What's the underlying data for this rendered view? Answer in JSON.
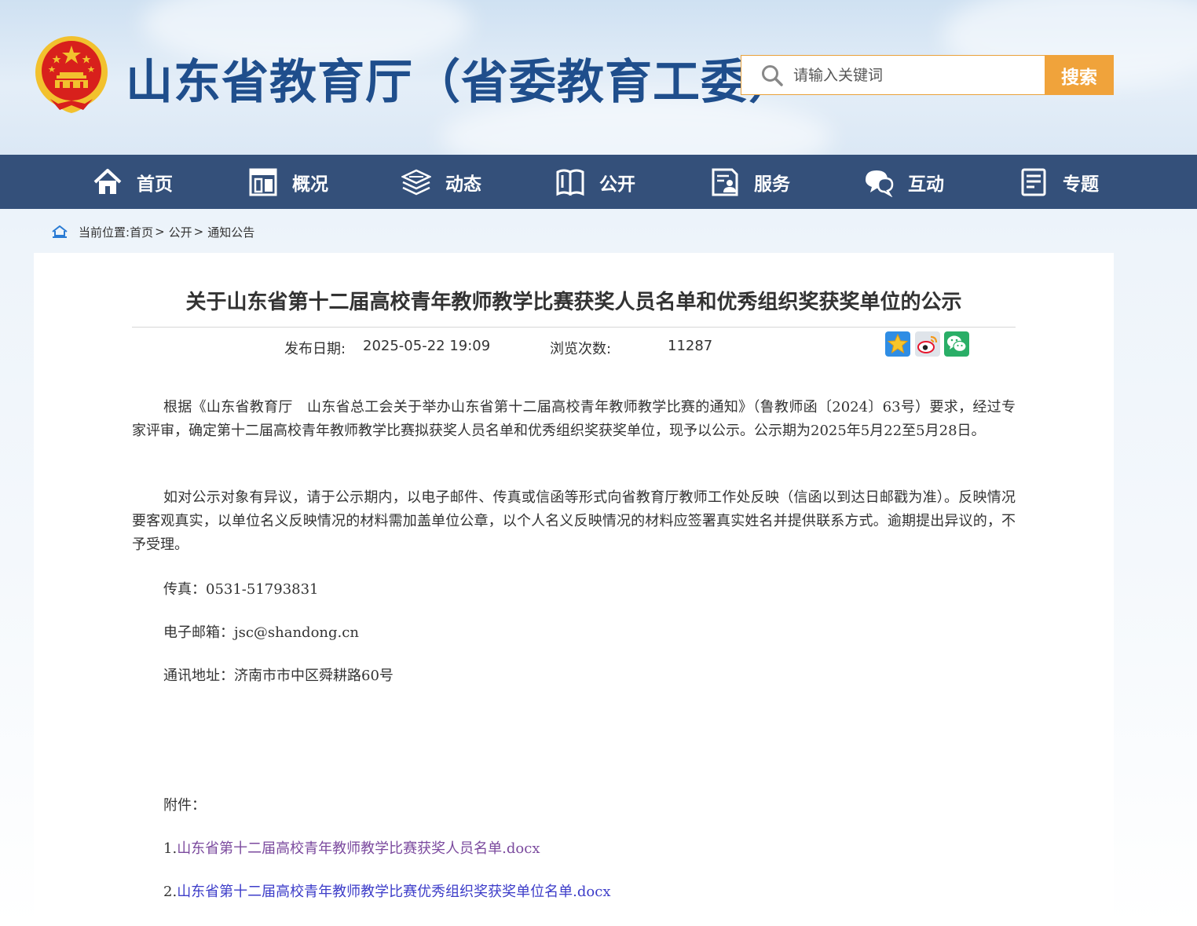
{
  "header": {
    "site_title": "山东省教育厅（省委教育工委）",
    "search_placeholder": "请输入关键词",
    "search_button": "搜索"
  },
  "nav": {
    "items": [
      {
        "label": "首页",
        "icon": "home-icon"
      },
      {
        "label": "概况",
        "icon": "building-icon"
      },
      {
        "label": "动态",
        "icon": "stack-icon"
      },
      {
        "label": "公开",
        "icon": "book-icon"
      },
      {
        "label": "服务",
        "icon": "service-icon"
      },
      {
        "label": "互动",
        "icon": "chat-icon"
      },
      {
        "label": "专题",
        "icon": "document-icon"
      }
    ]
  },
  "breadcrumb": {
    "prefix": "当前位置:",
    "items": [
      "首页",
      "公开",
      "通知公告"
    ],
    "separator": ">"
  },
  "article": {
    "title": "关于山东省第十二届高校青年教师教学比赛获奖人员名单和优秀组织奖获奖单位的公示",
    "publish_label": "发布日期:",
    "publish_date": "2025-05-22 19:09",
    "views_label": "浏览次数:",
    "views": "11287",
    "share": [
      "star-share-icon",
      "weibo-icon",
      "wechat-icon"
    ],
    "para1": "根据《山东省教育厅　山东省总工会关于举办山东省第十二届高校青年教师教学比赛的通知》（鲁教师函〔2024〕63号）要求，经过专家评审，确定第十二届高校青年教师教学比赛拟获奖人员名单和优秀组织奖获奖单位，现予以公示。公示期为2025年5月22至5月28日。",
    "para2": "如对公示对象有异议，请于公示期内，以电子邮件、传真或信函等形式向省教育厅教师工作处反映（信函以到达日邮戳为准）。反映情况要客观真实，以单位名义反映情况的材料需加盖单位公章，以个人名义反映情况的材料应签署真实姓名并提供联系方式。逾期提出异议的，不予受理。",
    "fax": "传真：0531-51793831",
    "email": "电子邮箱：jsc@shandong.cn",
    "address": "通讯地址：济南市市中区舜耕路60号",
    "attachments_label": "附件：",
    "attachments": [
      {
        "prefix": "1.",
        "name": "山东省第十二届高校青年教师教学比赛获奖人员名单.docx"
      },
      {
        "prefix": "2.",
        "name": "山东省第十二届高校青年教师教学比赛优秀组织奖获奖单位名单.docx"
      }
    ]
  },
  "colors": {
    "nav_bg": "#34507a",
    "title_blue": "#1f4e8c",
    "search_orange": "#f0a33b",
    "link_blue": "#3d3dc9",
    "link_visited": "#7b4a9e"
  }
}
